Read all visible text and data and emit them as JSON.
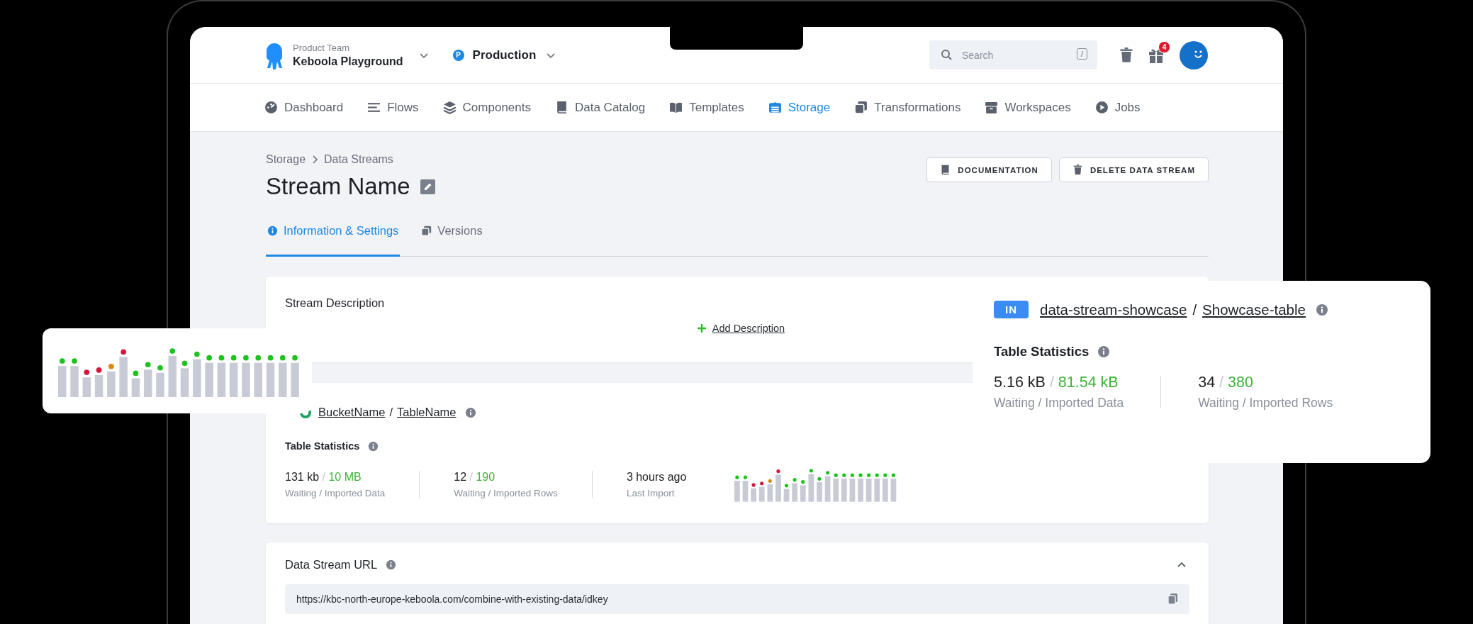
{
  "header": {
    "team_label": "Product Team",
    "project": "Keboola Playground",
    "environment_badge": "P",
    "environment": "Production",
    "search": {
      "placeholder": "Search",
      "shortcut": "/"
    },
    "notification_count": "4"
  },
  "nav": [
    {
      "label": "Dashboard",
      "selected": false
    },
    {
      "label": "Flows",
      "selected": false
    },
    {
      "label": "Components",
      "selected": false
    },
    {
      "label": "Data Catalog",
      "selected": false
    },
    {
      "label": "Templates",
      "selected": false
    },
    {
      "label": "Storage",
      "selected": true
    },
    {
      "label": "Transformations",
      "selected": false
    },
    {
      "label": "Workspaces",
      "selected": false
    },
    {
      "label": "Jobs",
      "selected": false
    }
  ],
  "breadcrumb": [
    "Storage",
    "Data Streams"
  ],
  "title": "Stream Name",
  "actions": [
    {
      "label": "DOCUMENTATION"
    },
    {
      "label": "DELETE DATA STREAM"
    }
  ],
  "tabs": [
    {
      "label": "Information & Settings",
      "selected": true
    },
    {
      "label": "Versions",
      "selected": false
    }
  ],
  "description_card": {
    "title": "Stream Description",
    "add_label": "Add Description"
  },
  "table_card": {
    "bucket": "BucketName",
    "slash": "/",
    "table": "TableName",
    "stats_title": "Table Statistics",
    "stats": [
      {
        "kind": "ratio",
        "waiting": "131 kb",
        "slash": "/",
        "imported": "10 MB",
        "caption": "Waiting / Imported Data"
      },
      {
        "kind": "ratio",
        "waiting": "12",
        "slash": "/",
        "imported": "190",
        "caption": "Waiting / Imported Rows"
      },
      {
        "kind": "time",
        "value": "3 hours ago",
        "caption": "Last Import"
      }
    ],
    "activity_bars": [
      {
        "color": "#1ec31e"
      },
      {
        "color": "#1ec31e"
      },
      {
        "color": "#d6153a"
      },
      {
        "color": "#d6153a"
      },
      {
        "color": "#d58a12"
      },
      {
        "color": "#d6153a"
      },
      {
        "color": "#1ec31e"
      },
      {
        "color": "#1ec31e"
      },
      {
        "color": "#1ec31e"
      },
      {
        "color": "#1ec31e"
      },
      {
        "color": "#1ec31e"
      },
      {
        "color": "#1ec31e"
      },
      {
        "color": "#1ec31e"
      },
      {
        "color": "#1ec31e"
      },
      {
        "color": "#1ec31e"
      },
      {
        "color": "#1ec31e"
      },
      {
        "color": "#1ec31e"
      },
      {
        "color": "#1ec31e"
      },
      {
        "color": "#1ec31e"
      },
      {
        "color": "#1ec31e"
      }
    ]
  },
  "url_card": {
    "title": "Data Stream URL",
    "expanded": true,
    "url": "https://kbc-north-europe-keboola.com/combine-with-existing-data/idkey"
  },
  "float_chart": {
    "bars": [
      {
        "color": "#1ec31e"
      },
      {
        "color": "#1ec31e"
      },
      {
        "color": "#d6153a"
      },
      {
        "color": "#d6153a"
      },
      {
        "color": "#d58a12"
      },
      {
        "color": "#d6153a"
      },
      {
        "color": "#1ec31e"
      },
      {
        "color": "#1ec31e"
      },
      {
        "color": "#1ec31e"
      },
      {
        "color": "#1ec31e"
      },
      {
        "color": "#1ec31e"
      },
      {
        "color": "#1ec31e"
      },
      {
        "color": "#1ec31e"
      },
      {
        "color": "#1ec31e"
      },
      {
        "color": "#1ec31e"
      },
      {
        "color": "#1ec31e"
      },
      {
        "color": "#1ec31e"
      },
      {
        "color": "#1ec31e"
      },
      {
        "color": "#1ec31e"
      },
      {
        "color": "#1ec31e"
      }
    ]
  },
  "float_table": {
    "direction": "IN",
    "bucket": "data-stream-showcase",
    "slash": "/",
    "table": "Showcase-table",
    "stats_title": "Table Statistics",
    "stats": [
      {
        "kind": "ratio",
        "waiting": "5.16 kB",
        "slash": "/",
        "imported": "81.54 kB",
        "caption": "Waiting / Imported Data"
      },
      {
        "kind": "ratio",
        "waiting": "34",
        "slash": "/",
        "imported": "380",
        "caption": "Waiting / Imported Rows"
      }
    ]
  }
}
